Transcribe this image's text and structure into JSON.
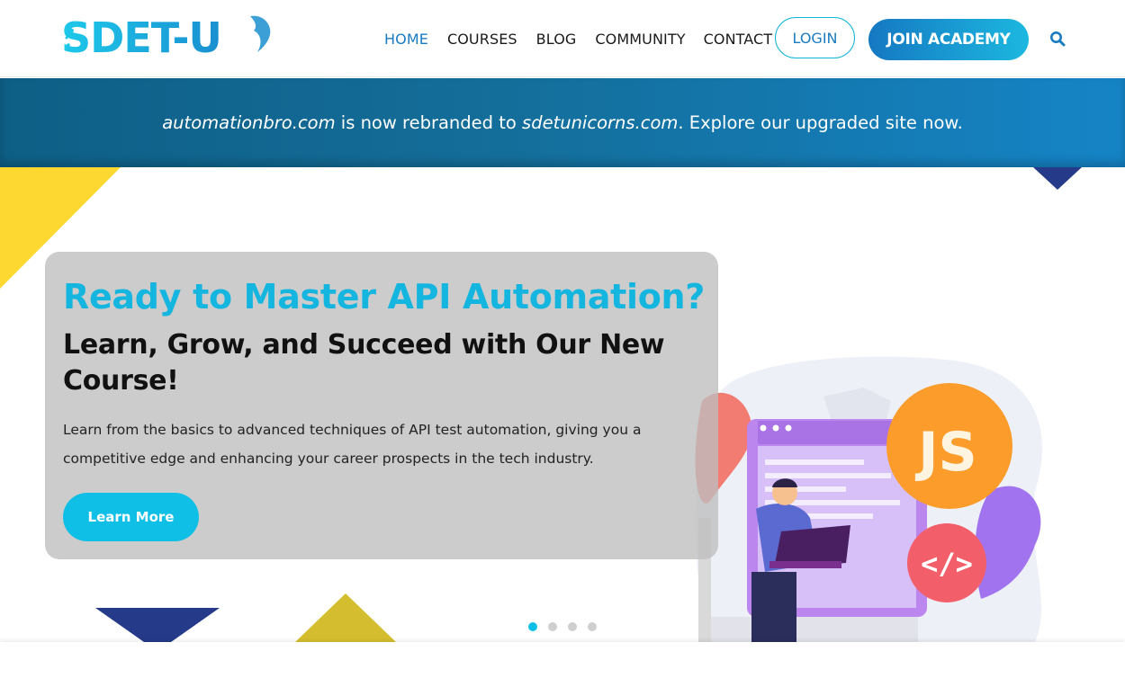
{
  "header": {
    "logo_text": "SDET-U",
    "nav": [
      {
        "label": "HOME",
        "active": true
      },
      {
        "label": "COURSES",
        "active": false
      },
      {
        "label": "BLOG",
        "active": false
      },
      {
        "label": "COMMUNITY",
        "active": false
      },
      {
        "label": "CONTACT",
        "active": false
      }
    ],
    "login_label": "LOGIN",
    "join_label": "JOIN ACADEMY",
    "search_icon": "search-icon"
  },
  "banner": {
    "old_domain": "automationbro.com",
    "middle_text": " is now rebranded to ",
    "new_domain": "sdetunicorns.com",
    "end_text": ". Explore our upgraded site now."
  },
  "hero": {
    "title": "Ready to Master API Automation?",
    "subtitle": "Learn, Grow, and Succeed with Our New Course!",
    "description": "Learn from the basics to advanced techniques of API test automation, giving you a competitive edge and enhancing your career prospects in the tech industry.",
    "cta_label": "Learn More",
    "illustration_js": "JS",
    "illustration_code": "</>",
    "slides": [
      {
        "active": true
      },
      {
        "active": false
      },
      {
        "active": false
      },
      {
        "active": false
      }
    ]
  },
  "colors": {
    "accent": "#0fbfe6",
    "brand_blue": "#1b7bc0",
    "yellow": "#fcd830",
    "navy": "#253a88"
  }
}
